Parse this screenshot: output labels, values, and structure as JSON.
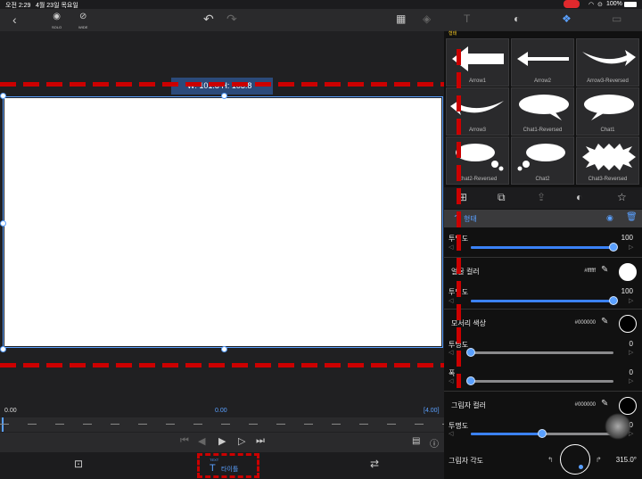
{
  "status": {
    "time": "오전 2:29",
    "date": "4월 23일 목요일",
    "battery": "100%"
  },
  "toolbar": {
    "eye_label": "SOLO",
    "eye2_label": "WIDE"
  },
  "canvas": {
    "size_readout": "W: 101.8 H: 103.8"
  },
  "timeline": {
    "start": "0.00",
    "current": "0.00",
    "end": "[4.00]"
  },
  "bottom_tab": {
    "icon_label": "TEXT",
    "label": "타이틀"
  },
  "shapes": {
    "section_label": "형태",
    "items": [
      {
        "name": "Arrow1"
      },
      {
        "name": "Arrow2"
      },
      {
        "name": "Arrow3-Reversed"
      },
      {
        "name": "Arrow3"
      },
      {
        "name": "Chat1-Reversed"
      },
      {
        "name": "Chat1"
      },
      {
        "name": "Chat2-Reversed"
      },
      {
        "name": "Chat2"
      },
      {
        "name": "Chat3-Reversed"
      }
    ]
  },
  "panel": {
    "header": "형태",
    "opacity_label": "투명도",
    "opacity_value": "100",
    "face_color_label": "얼굴 컬러",
    "face_color_hex": "#ffffff",
    "face_opacity_label": "투명도",
    "face_opacity_value": "100",
    "edge_color_label": "모서리 색상",
    "edge_color_hex": "#000000",
    "edge_opacity_label": "투명도",
    "edge_opacity_value": "0",
    "width_label": "폭",
    "width_value": "0",
    "shadow_color_label": "그림자 컬러",
    "shadow_color_hex": "#000000",
    "shadow_opacity_label": "투명도",
    "shadow_opacity_value": "50",
    "shadow_angle_label": "그림자 각도",
    "shadow_angle_value": "315.0°"
  },
  "slider_levels": {
    "opacity": 1.0,
    "face_opacity": 1.0,
    "edge_opacity": 0.0,
    "width": 0.0,
    "shadow_opacity": 0.5
  }
}
